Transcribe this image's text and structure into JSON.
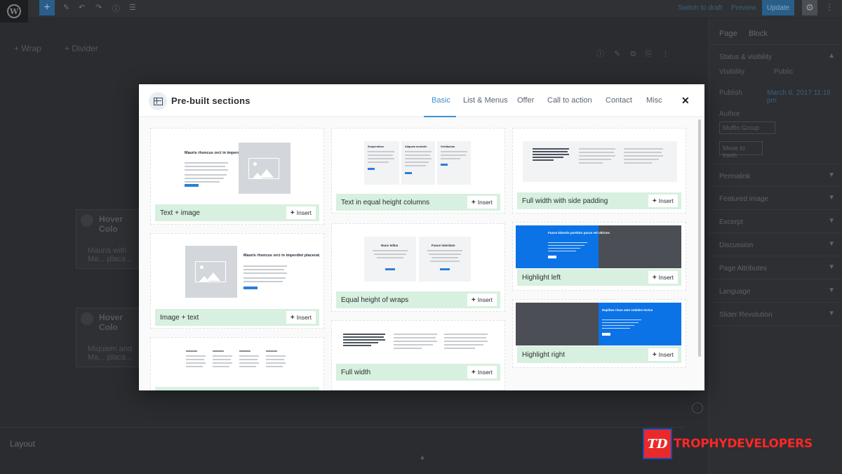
{
  "editor": {
    "topbar": {
      "switch_to_draft": "Switch to draft",
      "preview": "Preview",
      "update": "Update"
    },
    "canvas": {
      "wrap_label": "+ Wrap",
      "divider_label": "+ Divider",
      "blocks": [
        {
          "title": "Hover Colo",
          "text": "Mauris with Ma... placa..."
        },
        {
          "title": "Hover Colo",
          "text": "Miquiem and Ma... placa..."
        }
      ],
      "layout_label": "Layout"
    },
    "sidebar": {
      "tabs": [
        "Page",
        "Block"
      ],
      "status_visibility": "Status & visibility",
      "visibility_label": "Visibility",
      "visibility_value": "Public",
      "publish_label": "Publish",
      "publish_value": "March 8, 2017 11:16 pm",
      "author_label": "Author",
      "author_value": "Muffin Group",
      "move_to_trash": "Move to trash",
      "panels": [
        "Permalink",
        "Featured image",
        "Excerpt",
        "Discussion",
        "Page Attributes",
        "Language",
        "Slider Revolution"
      ]
    }
  },
  "modal": {
    "title": "Pre-built sections",
    "tabs": [
      {
        "label": "Basic",
        "active": true
      },
      {
        "label": "List & Menus",
        "active": false
      },
      {
        "label": "Offer",
        "active": false
      },
      {
        "label": "Call to action",
        "active": false
      },
      {
        "label": "Contact",
        "active": false
      },
      {
        "label": "Misc",
        "active": false
      }
    ],
    "insert_label": "Insert",
    "sections": [
      {
        "name": "Text + image",
        "preview_title": "Mauris rhoncus orci in imperdiet placerat."
      },
      {
        "name": "Image + text",
        "preview_title": "Mauris rhoncus orci in imperdiet placerat."
      },
      {
        "name": "Text in equal height columns",
        "preview_headings": [
          "Suspendisse",
          "Aliquam molestie",
          "Vestibulum"
        ]
      },
      {
        "name": "Equal height of wraps",
        "preview_headings": [
          "Nunc tellus",
          "Fusce interdum"
        ]
      },
      {
        "name": "Full width"
      },
      {
        "name": "Full width with side padding"
      },
      {
        "name": "Highlight left",
        "preview_title": "Fusce lobortis porttitor purus vel ultrices"
      },
      {
        "name": "Highlight right",
        "preview_title": "Dapibus risus aste sodales lectus"
      }
    ],
    "accent_color": "#3f8fd1",
    "footer_color": "#d8f0df",
    "preview_blue": "#0b73e6"
  },
  "watermark": {
    "logo_letters": "TD",
    "text": "TROPHYDEVELOPERS"
  }
}
